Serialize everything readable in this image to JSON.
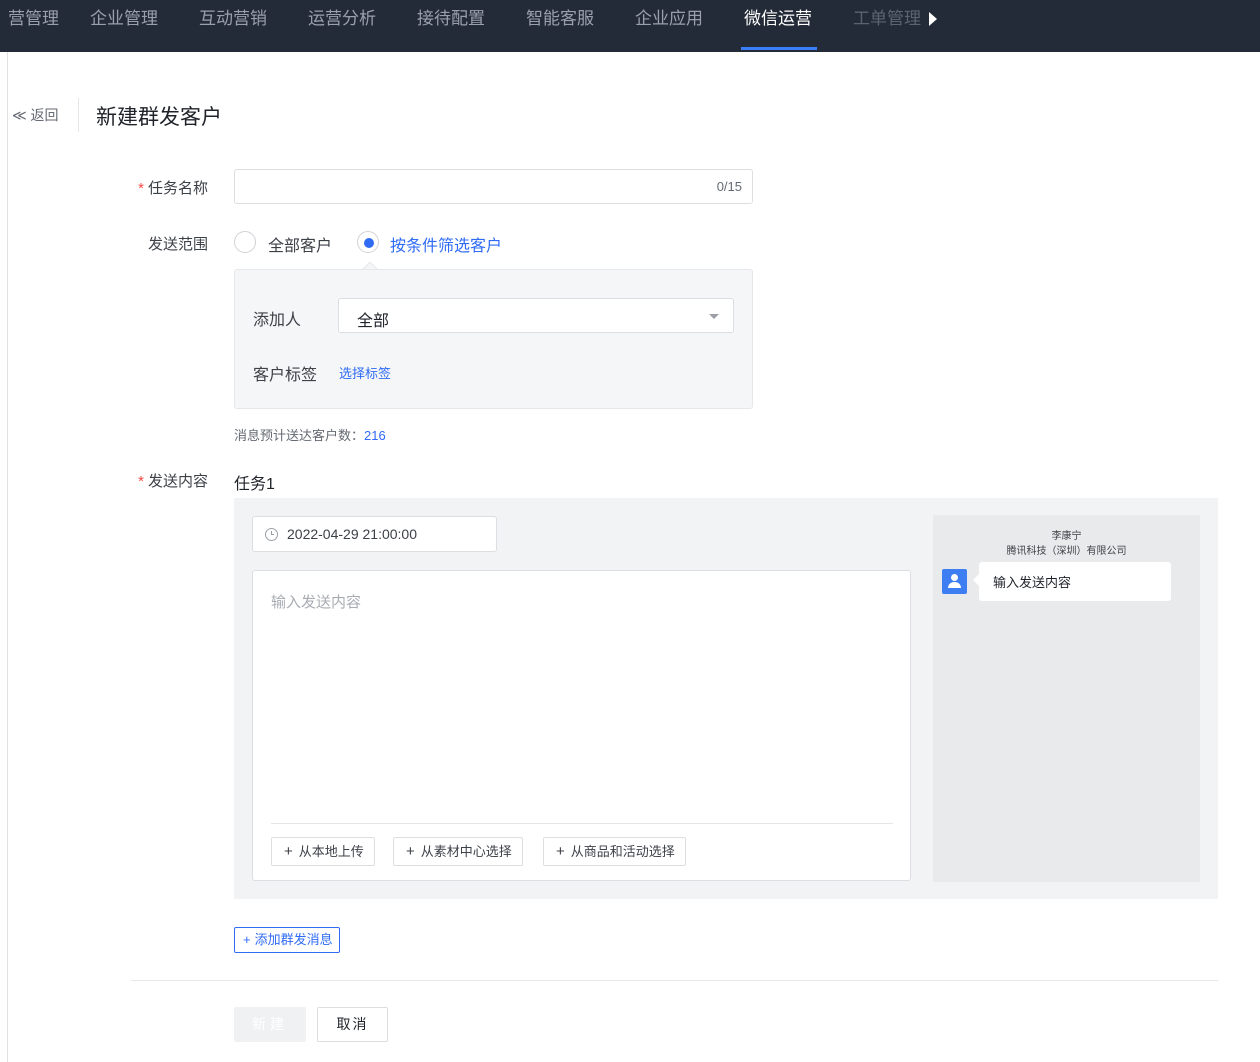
{
  "nav": {
    "items": [
      "营管理",
      "企业管理",
      "互动营销",
      "运营分析",
      "接待配置",
      "智能客服",
      "企业应用",
      "微信运营",
      "工单管理"
    ],
    "active": "微信运营"
  },
  "header": {
    "back_label": "≪ 返回",
    "title": "新建群发客户"
  },
  "form": {
    "task_name": {
      "label": "任务名称",
      "required": true,
      "value": "",
      "counter": "0/15"
    },
    "scope": {
      "label": "发送范围",
      "options": [
        "全部客户",
        "按条件筛选客户"
      ],
      "selected": "按条件筛选客户"
    },
    "filter": {
      "adder_label": "添加人",
      "adder_value": "全部",
      "tags_label": "客户标签",
      "tags_link": "选择标签"
    },
    "estimate": {
      "label": "消息预计送达客户数：",
      "count": "216"
    },
    "content": {
      "label": "发送内容",
      "required": true,
      "task_title": "任务1",
      "datetime": "2022-04-29 21:00:00",
      "placeholder": "输入发送内容",
      "upload_buttons": [
        "从本地上传",
        "从素材中心选择",
        "从商品和活动选择"
      ]
    },
    "preview": {
      "name": "李康宁",
      "company": "腾讯科技（深圳）有限公司",
      "bubble_text": "输入发送内容"
    },
    "add_message_label": "添加群发消息"
  },
  "footer": {
    "create_label": "新建",
    "cancel_label": "取消"
  },
  "colors": {
    "nav_bg": "#242b38",
    "accent": "#2f6bf5",
    "required": "#f54a45"
  }
}
